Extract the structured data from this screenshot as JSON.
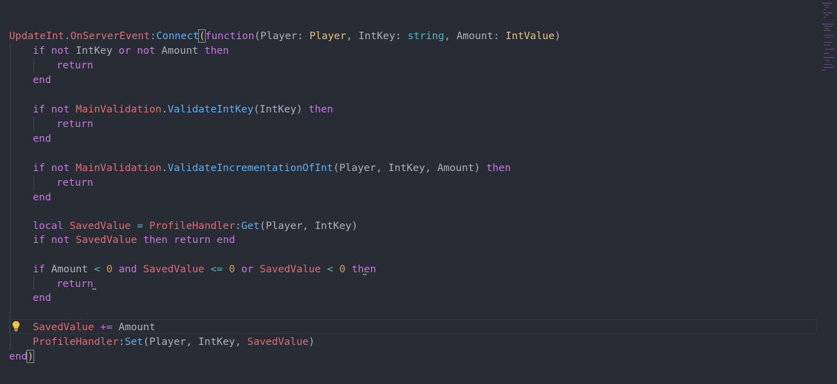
{
  "editor": {
    "lines": [
      [
        "UpdateInt",
        ".",
        "OnServerEvent",
        ":",
        "Connect",
        "(",
        "function",
        "(Player: ",
        "Player",
        ", IntKey: ",
        "string",
        ", Amount: ",
        "IntValue",
        ")"
      ],
      [
        "if",
        " ",
        "not",
        " IntKey ",
        "or",
        " ",
        "not",
        " Amount ",
        "then"
      ],
      [
        "return"
      ],
      [
        "end"
      ],
      [
        "if",
        " ",
        "not",
        " ",
        "MainValidation",
        ".",
        "ValidateIntKey",
        "(IntKey) ",
        "then"
      ],
      [
        "return"
      ],
      [
        "end"
      ],
      [
        "if",
        " ",
        "not",
        " ",
        "MainValidation",
        ".",
        "ValidateIncrementationOfInt",
        "(Player, IntKey, Amount) ",
        "then"
      ],
      [
        "return"
      ],
      [
        "end"
      ],
      [
        "local",
        " ",
        "SavedValue",
        " ",
        "=",
        " ",
        "ProfileHandler",
        ":",
        "Get",
        "(Player, IntKey)"
      ],
      [
        "if",
        " ",
        "not",
        " ",
        "SavedValue",
        " ",
        "then",
        " ",
        "return",
        " ",
        "end"
      ],
      [
        "if",
        " Amount ",
        "<",
        " ",
        "0",
        " ",
        "and",
        " ",
        "SavedValue",
        " ",
        "<=",
        " ",
        "0",
        " ",
        "or",
        " ",
        "SavedValue",
        " ",
        "<",
        " ",
        "0",
        " ",
        "then"
      ],
      [
        "return"
      ],
      [
        "end"
      ],
      [
        "SavedValue",
        " ",
        "+=",
        " Amount"
      ],
      [
        "ProfileHandler",
        ":",
        "Set",
        "(Player, IntKey, ",
        "SavedValue",
        ")"
      ],
      [
        "end",
        ")"
      ]
    ]
  },
  "colors": {
    "background": "#282c34",
    "keyword": "#c678dd",
    "variable": "#e06c75",
    "function": "#61afef",
    "type": "#e5c07b",
    "builtin": "#56b6c2",
    "number": "#d19a66",
    "plain": "#abb2bf"
  },
  "icons": {
    "lightbulb": "lightbulb-icon"
  }
}
